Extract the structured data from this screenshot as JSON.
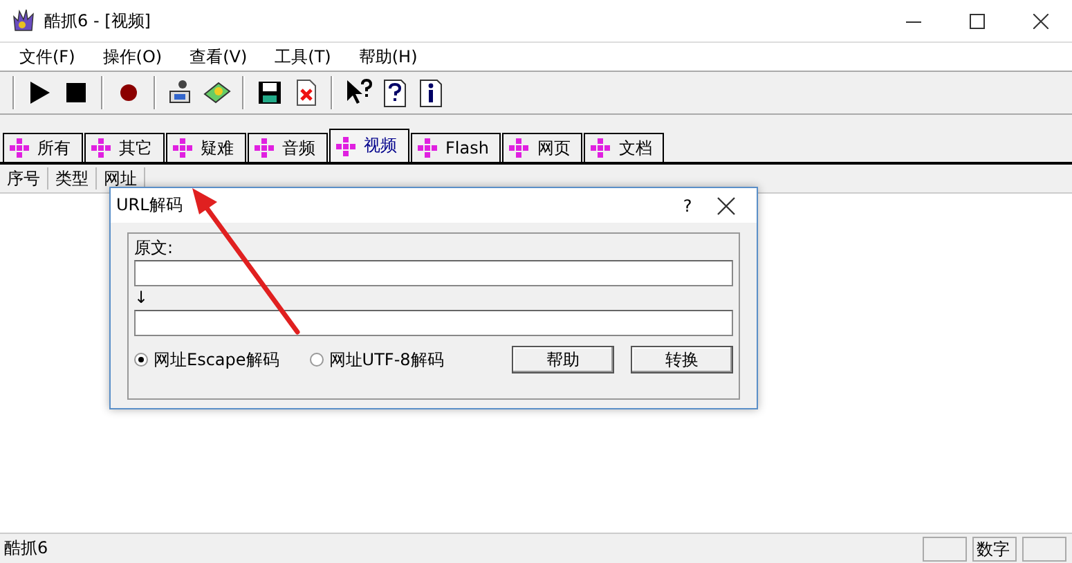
{
  "window": {
    "title": "酷抓6 - [视频]"
  },
  "menu": [
    "文件(F)",
    "操作(O)",
    "查看(V)",
    "工具(T)",
    "帮助(H)"
  ],
  "tabs": [
    {
      "label": "所有",
      "selected": false
    },
    {
      "label": "其它",
      "selected": false
    },
    {
      "label": "疑难",
      "selected": false
    },
    {
      "label": "音频",
      "selected": false
    },
    {
      "label": "视频",
      "selected": true
    },
    {
      "label": "Flash",
      "selected": false
    },
    {
      "label": "网页",
      "selected": false
    },
    {
      "label": "文档",
      "selected": false
    }
  ],
  "table": {
    "columns": [
      "序号",
      "类型",
      "网址"
    ]
  },
  "dialog": {
    "title": "URL解码",
    "help_glyph": "?",
    "source_label": "原文:",
    "arrow_label": "↓",
    "options": [
      {
        "label": "网址Escape解码",
        "selected": true
      },
      {
        "label": "网址UTF-8解码",
        "selected": false
      }
    ],
    "buttons": [
      "帮助",
      "转换"
    ]
  },
  "status_bar": {
    "text": "酷抓6",
    "indicator": "数字"
  }
}
